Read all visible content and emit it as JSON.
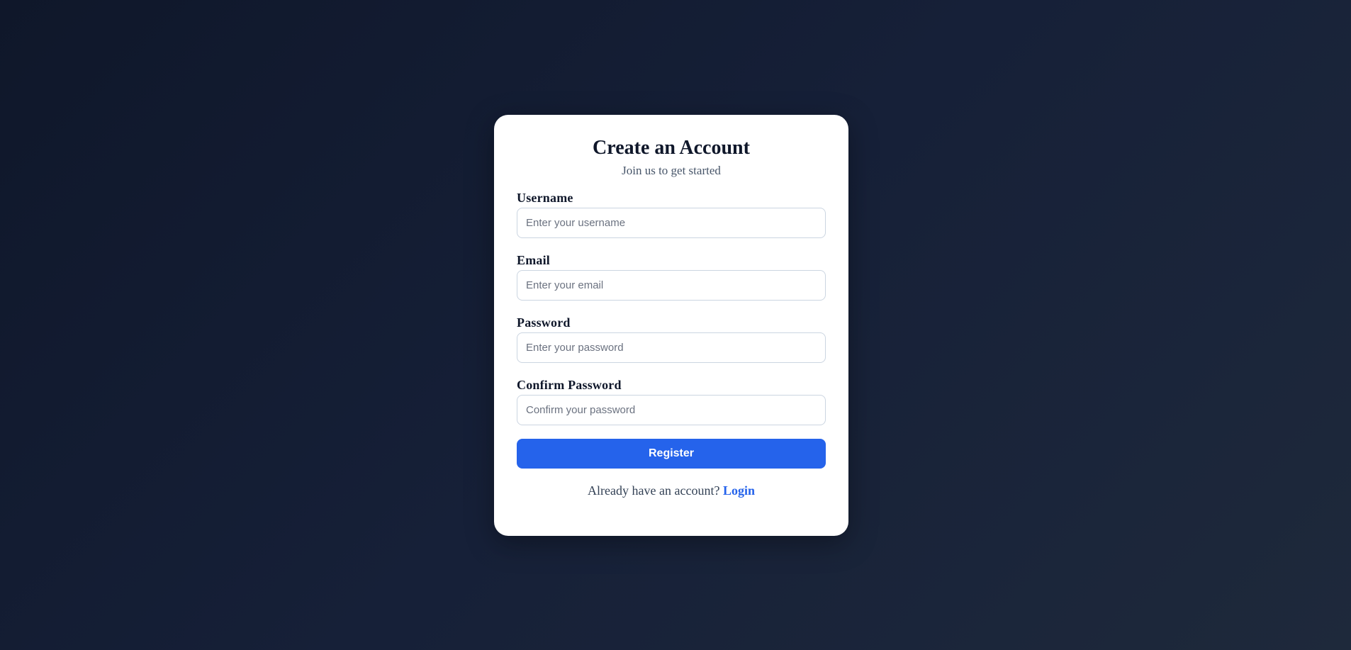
{
  "card": {
    "title": "Create an Account",
    "subtitle": "Join us to get started"
  },
  "form": {
    "username": {
      "label": "Username",
      "placeholder": "Enter your username",
      "value": ""
    },
    "email": {
      "label": "Email",
      "placeholder": "Enter your email",
      "value": ""
    },
    "password": {
      "label": "Password",
      "placeholder": "Enter your password",
      "value": ""
    },
    "confirm_password": {
      "label": "Confirm Password",
      "placeholder": "Confirm your password",
      "value": ""
    },
    "submit_label": "Register"
  },
  "footer": {
    "prompt": "Already have an account?",
    "login_label": "Login"
  },
  "colors": {
    "accent": "#2563eb",
    "background": "#0f172a",
    "card": "#ffffff",
    "text": "#0f172a"
  }
}
